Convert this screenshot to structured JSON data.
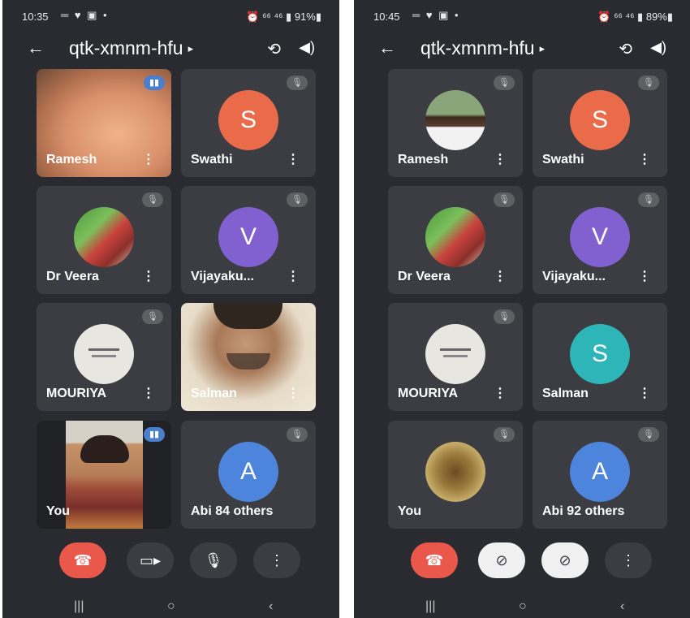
{
  "screens": [
    {
      "status": {
        "time": "10:35",
        "icons": "═ ♥ ▣ •",
        "right": "⏰ ⁶⁶ ⁴⁶ ▮ 91%▮"
      },
      "header": {
        "title": "qtk-xmnm-hfu",
        "title_chevron": "▸",
        "back_icon": "arrow-left-icon",
        "switch_camera_icon": "camera-switch-icon",
        "speaker_icon": "speaker-icon"
      },
      "tiles": [
        {
          "name": "Ramesh",
          "more": "⋮",
          "badge": "talking"
        },
        {
          "name": "Swathi",
          "more": "⋮",
          "avatar_letter": "S",
          "badge": "muted"
        },
        {
          "name": "Dr Veera",
          "more": "⋮",
          "badge": "muted"
        },
        {
          "name": "Vijayaku...",
          "more": "⋮",
          "avatar_letter": "V",
          "badge": "muted"
        },
        {
          "name": "MOURIYA",
          "more": "⋮",
          "badge": "muted"
        },
        {
          "name": "Salman",
          "more": "⋮"
        },
        {
          "name": "You",
          "badge": "talking"
        },
        {
          "name": "Abi 84 others",
          "avatar_letter": "A",
          "badge": "muted"
        }
      ],
      "controls": {
        "end_icon": "end-call-icon",
        "camera_icon": "video-camera-icon",
        "mic_icon": "microphone-icon",
        "more_icon": "more-vertical-icon"
      },
      "nav": {
        "recents": "|||",
        "home": "○",
        "back": "‹"
      }
    },
    {
      "status": {
        "time": "10:45",
        "icons": "═ ♥ ▣ •",
        "right": "⏰ ⁶⁶ ⁴⁶ ▮ 89%▮"
      },
      "header": {
        "title": "qtk-xmnm-hfu",
        "title_chevron": "▸",
        "back_icon": "arrow-left-icon",
        "switch_camera_icon": "camera-switch-icon",
        "speaker_icon": "speaker-icon"
      },
      "tiles": [
        {
          "name": "Ramesh",
          "more": "⋮",
          "badge": "muted"
        },
        {
          "name": "Swathi",
          "more": "⋮",
          "avatar_letter": "S",
          "badge": "muted"
        },
        {
          "name": "Dr Veera",
          "more": "⋮",
          "badge": "muted"
        },
        {
          "name": "Vijayaku...",
          "more": "⋮",
          "avatar_letter": "V",
          "badge": "muted"
        },
        {
          "name": "MOURIYA",
          "more": "⋮",
          "badge": "muted"
        },
        {
          "name": "Salman",
          "more": "⋮",
          "avatar_letter": "S"
        },
        {
          "name": "You",
          "badge": "muted"
        },
        {
          "name": "Abi 92 others",
          "avatar_letter": "A",
          "badge": "muted"
        }
      ],
      "controls": {
        "end_icon": "end-call-icon",
        "camera_icon": "video-camera-off-icon",
        "mic_icon": "microphone-off-icon",
        "more_icon": "more-vertical-icon"
      },
      "nav": {
        "recents": "|||",
        "home": "○",
        "back": "‹"
      }
    }
  ],
  "colors": {
    "background": "#2a2b30",
    "tile": "#3c3d42",
    "end_call": "#e9584b",
    "avatar_orange": "#ea6b49",
    "avatar_purple": "#8161cf",
    "avatar_blue": "#4d84dc",
    "avatar_teal": "#2db5b8"
  }
}
